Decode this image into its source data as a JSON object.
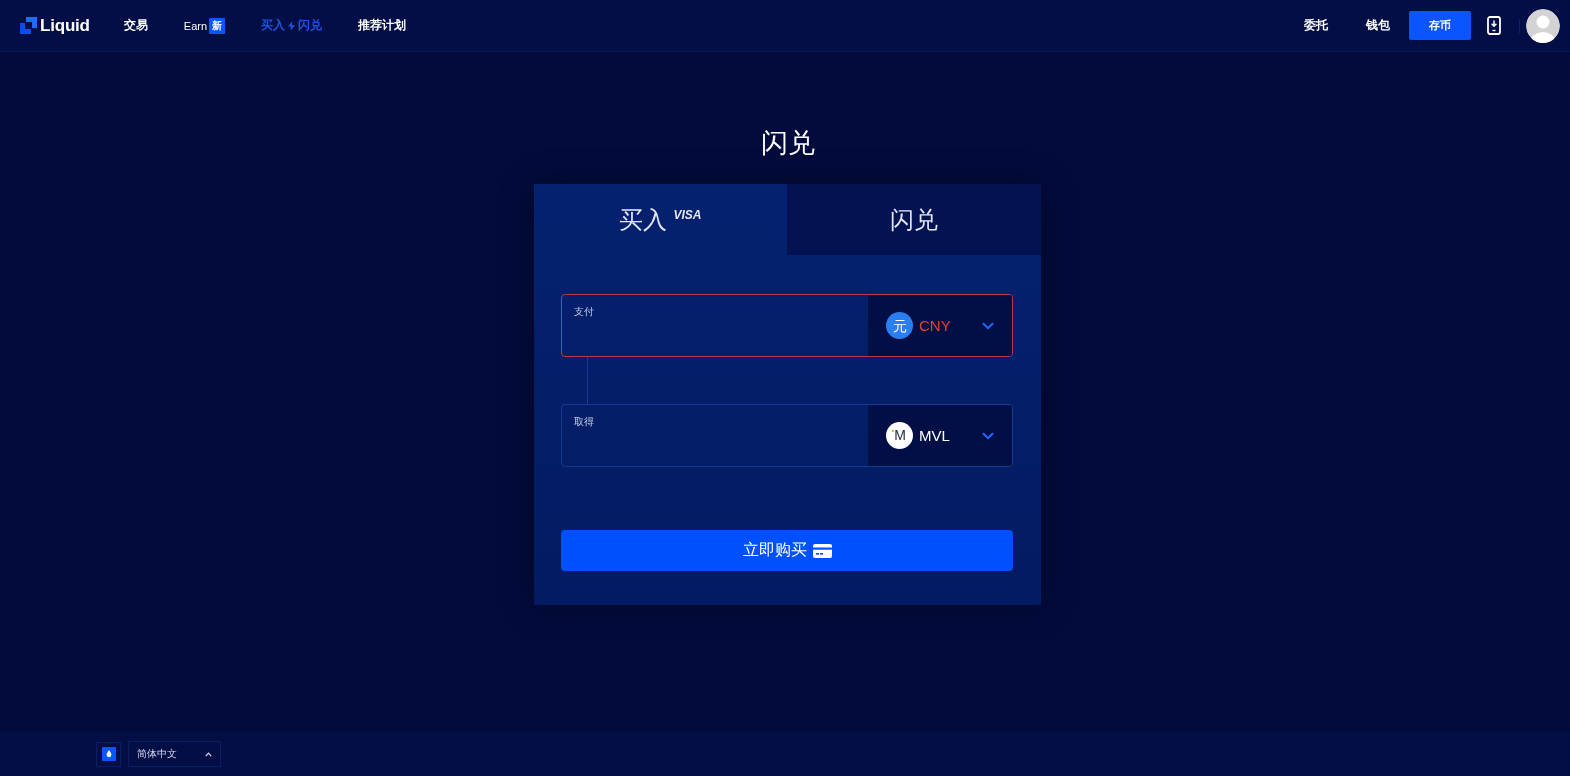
{
  "header": {
    "brand": "Liquid",
    "nav": [
      {
        "kind": "plain",
        "label": "交易",
        "selected": false
      },
      {
        "kind": "badge",
        "label": "Earn",
        "badge": "新",
        "selected": false
      },
      {
        "kind": "bolt",
        "label": "买入",
        "label_after": "闪兑",
        "selected": true
      },
      {
        "kind": "plain",
        "label": "推荐计划",
        "selected": false
      }
    ],
    "right_links": [
      "委托",
      "钱包"
    ],
    "deposit_button": "存币"
  },
  "page_title": "闪兑",
  "card": {
    "tabs": [
      {
        "label": "买入",
        "badge": "VISA",
        "selected": true
      },
      {
        "label": "闪兑",
        "selected": false
      }
    ],
    "fields": [
      {
        "kind": "yuan",
        "label": "支付",
        "currency": "CNY",
        "coin_glyph": "元",
        "invalid": true
      },
      {
        "kind": "mvl",
        "label": "取得",
        "currency": "MVL",
        "coin_glyph": "M",
        "invalid": false
      }
    ],
    "submit_button": "立即购买"
  },
  "footer": {
    "language": "简体中文"
  }
}
